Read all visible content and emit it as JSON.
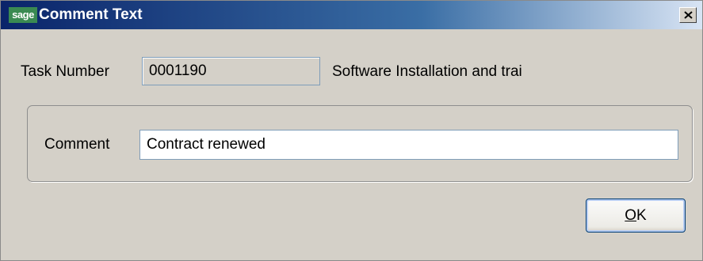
{
  "window": {
    "logo_text": "sage",
    "title": "Comment Text",
    "close_glyph": "close-icon"
  },
  "task": {
    "label": "Task Number",
    "number": "0001190",
    "description": "Software Installation and trai"
  },
  "comment": {
    "label": "Comment",
    "value": "Contract renewed"
  },
  "buttons": {
    "ok_mnemonic": "O",
    "ok_rest": "K"
  },
  "colors": {
    "titlebar_start": "#0a246a",
    "titlebar_end": "#d8e4f4",
    "face": "#d4d0c8",
    "logo_green": "#3a8a52"
  }
}
